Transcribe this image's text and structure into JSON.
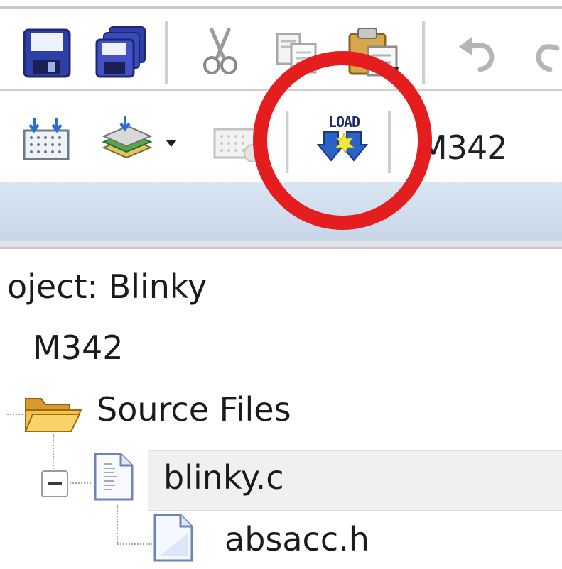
{
  "toolbar": {
    "items": [
      {
        "name": "save-icon"
      },
      {
        "name": "save-all-icon"
      },
      {
        "name": "cut-icon"
      },
      {
        "name": "copy-icon"
      },
      {
        "name": "paste-icon"
      },
      {
        "name": "undo-icon"
      },
      {
        "name": "redo-icon"
      }
    ]
  },
  "build_toolbar": {
    "load_icon_text": "LOAD",
    "target_select_value": "M342"
  },
  "project_tree": {
    "project_label": "oject: Blinky",
    "target_name": "M342",
    "group_name": "Source Files",
    "files": [
      {
        "name": "blinky.c"
      },
      {
        "name": "absacc.h"
      }
    ]
  },
  "highlight": {
    "color": "#e41e1e"
  }
}
